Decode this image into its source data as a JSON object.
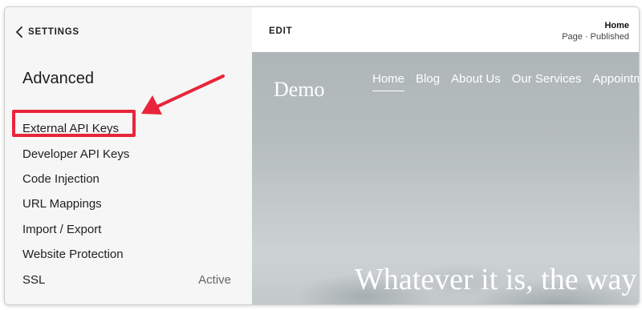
{
  "sidebar": {
    "back_label": "SETTINGS",
    "section_title": "Advanced",
    "items": [
      {
        "label": "External API Keys",
        "status": ""
      },
      {
        "label": "Developer API Keys",
        "status": ""
      },
      {
        "label": "Code Injection",
        "status": ""
      },
      {
        "label": "URL Mappings",
        "status": ""
      },
      {
        "label": "Import / Export",
        "status": ""
      },
      {
        "label": "Website Protection",
        "status": ""
      },
      {
        "label": "SSL",
        "status": "Active"
      }
    ]
  },
  "editor": {
    "edit_label": "EDIT",
    "page_name": "Home",
    "page_status": "Page · Published"
  },
  "site": {
    "logo": "Demo",
    "nav": [
      "Home",
      "Blog",
      "About Us",
      "Our Services",
      "Appointments"
    ],
    "hero_text": "Whatever it is, the way"
  },
  "annotation": {
    "highlight_color": "#e8253a",
    "icons": [
      "chevron-left-icon",
      "arrow-icon"
    ]
  }
}
